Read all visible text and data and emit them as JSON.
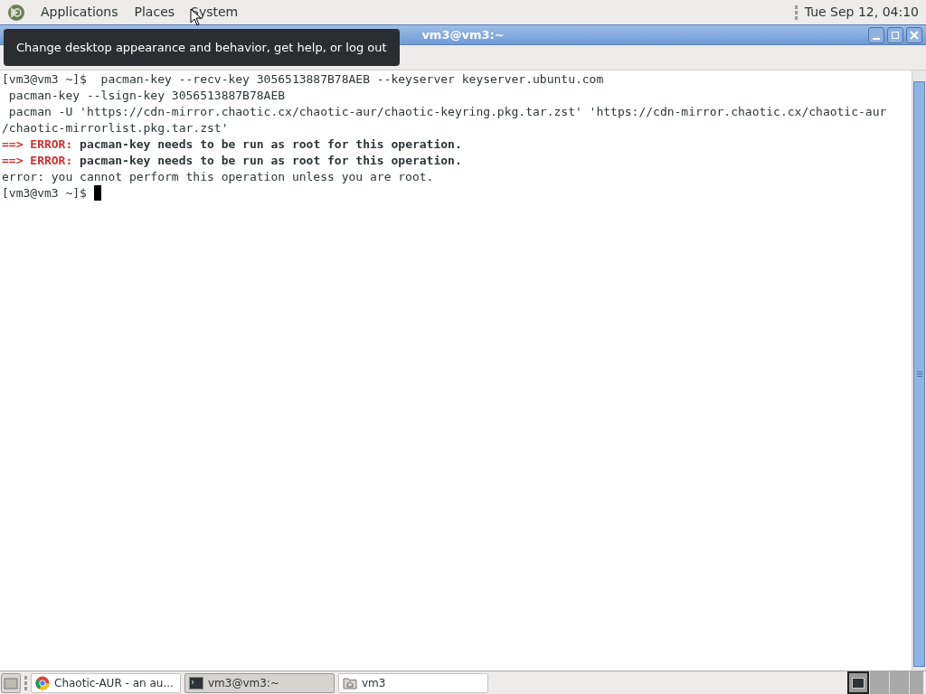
{
  "top_panel": {
    "menus": [
      "Applications",
      "Places",
      "System"
    ],
    "clock": "Tue Sep 12, 04:10"
  },
  "tooltip": "Change desktop appearance and behavior, get help, or log out",
  "window": {
    "title": "vm3@vm3:~"
  },
  "terminal": {
    "lines": [
      {
        "kind": "text",
        "text": "[vm3@vm3 ~]$  pacman-key --recv-key 3056513887B78AEB --keyserver keyserver.ubuntu.com"
      },
      {
        "kind": "text",
        "text": " pacman-key --lsign-key 3056513887B78AEB"
      },
      {
        "kind": "text",
        "text": " pacman -U 'https://cdn-mirror.chaotic.cx/chaotic-aur/chaotic-keyring.pkg.tar.zst' 'https://cdn-mirror.chaotic.cx/chaotic-aur"
      },
      {
        "kind": "text",
        "text": "/chaotic-mirrorlist.pkg.tar.zst'"
      },
      {
        "kind": "error",
        "arrow": "==>",
        "label": "ERROR:",
        "message": "pacman-key needs to be run as root for this operation."
      },
      {
        "kind": "error",
        "arrow": "==>",
        "label": "ERROR:",
        "message": "pacman-key needs to be run as root for this operation."
      },
      {
        "kind": "text",
        "text": "error: you cannot perform this operation unless you are root."
      },
      {
        "kind": "prompt",
        "text": "[vm3@vm3 ~]$ "
      }
    ]
  },
  "taskbar": {
    "tasks": [
      {
        "kind": "browser",
        "label": "Chaotic-AUR - an au...",
        "selected": false
      },
      {
        "kind": "terminal",
        "label": "vm3@vm3:~",
        "selected": true
      },
      {
        "kind": "folder",
        "label": "vm3",
        "selected": false
      }
    ]
  }
}
